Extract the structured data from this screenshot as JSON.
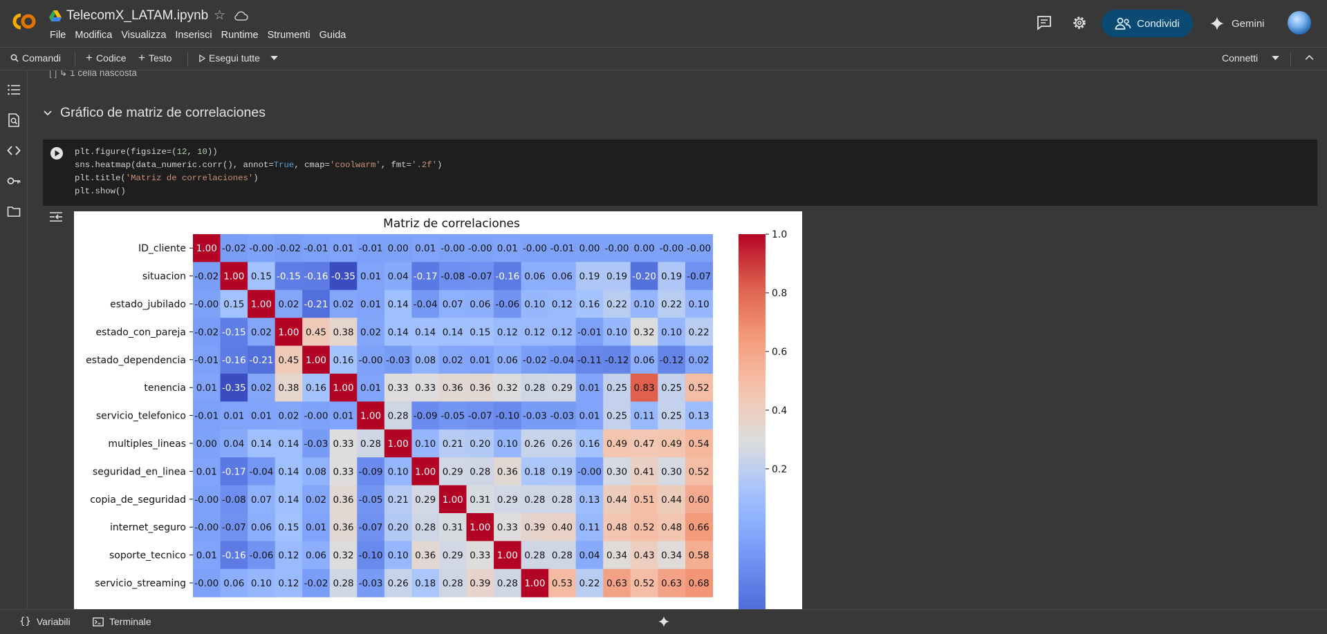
{
  "app": {
    "logo": "CO",
    "title": "TelecomX_LATAM.ipynb",
    "menu": [
      "File",
      "Modifica",
      "Visualizza",
      "Inserisci",
      "Runtime",
      "Strumenti",
      "Guida"
    ],
    "share_label": "Condividi",
    "gemini_label": "Gemini"
  },
  "toolbar": {
    "commands": "Comandi",
    "code": "Codice",
    "text": "Testo",
    "run_all": "Esegui tutte",
    "connect": "Connetti"
  },
  "notebook": {
    "hidden_cells": "↳ 1 cella nascosta",
    "section_title": "Gráfico de matriz de correlaciones",
    "code_lines": [
      "plt.figure(figsize=(12, 10))",
      "sns.heatmap(data_numeric.corr(), annot=True, cmap='coolwarm', fmt='.2f')",
      "plt.title('Matriz de correlaciones')",
      "plt.show()"
    ]
  },
  "status": {
    "variables": "Variabili",
    "terminal": "Terminale"
  },
  "chart_data": {
    "type": "heatmap",
    "title": "Matriz de correlaciones",
    "colormap": "coolwarm",
    "rows": [
      "ID_cliente",
      "situacion",
      "estado_jubilado",
      "estado_con_pareja",
      "estado_dependencia",
      "tenencia",
      "servicio_telefonico",
      "multiples_lineas",
      "seguridad_en_linea",
      "copia_de_seguridad",
      "internet_seguro",
      "soporte_tecnico",
      "servicio_streaming"
    ],
    "values": [
      [
        1.0,
        -0.02,
        -0.0,
        -0.02,
        -0.01,
        0.01,
        -0.01,
        0.0,
        0.01,
        -0.0,
        -0.0,
        0.01,
        -0.0,
        -0.01,
        0.0,
        -0.0,
        0.0,
        -0.0,
        -0.0
      ],
      [
        -0.02,
        1.0,
        0.15,
        -0.15,
        -0.16,
        -0.35,
        0.01,
        0.04,
        -0.17,
        -0.08,
        -0.07,
        -0.16,
        0.06,
        0.06,
        0.19,
        0.19,
        -0.2,
        0.19,
        -0.07
      ],
      [
        -0.0,
        0.15,
        1.0,
        0.02,
        -0.21,
        0.02,
        0.01,
        0.14,
        -0.04,
        0.07,
        0.06,
        -0.06,
        0.1,
        0.12,
        0.16,
        0.22,
        0.1,
        0.22,
        0.1
      ],
      [
        -0.02,
        -0.15,
        0.02,
        1.0,
        0.45,
        0.38,
        0.02,
        0.14,
        0.14,
        0.14,
        0.15,
        0.12,
        0.12,
        0.12,
        -0.01,
        0.1,
        0.32,
        0.1,
        0.22
      ],
      [
        -0.01,
        -0.16,
        -0.21,
        0.45,
        1.0,
        0.16,
        -0.0,
        -0.03,
        0.08,
        0.02,
        0.01,
        0.06,
        -0.02,
        -0.04,
        -0.11,
        -0.12,
        0.06,
        -0.12,
        0.02
      ],
      [
        0.01,
        -0.35,
        0.02,
        0.38,
        0.16,
        1.0,
        0.01,
        0.33,
        0.33,
        0.36,
        0.36,
        0.32,
        0.28,
        0.29,
        0.01,
        0.25,
        0.83,
        0.25,
        0.52
      ],
      [
        -0.01,
        0.01,
        0.01,
        0.02,
        -0.0,
        0.01,
        1.0,
        0.28,
        -0.09,
        -0.05,
        -0.07,
        -0.1,
        -0.03,
        -0.03,
        0.01,
        0.25,
        0.11,
        0.25,
        0.13
      ],
      [
        0.0,
        0.04,
        0.14,
        0.14,
        -0.03,
        0.33,
        0.28,
        1.0,
        0.1,
        0.21,
        0.2,
        0.1,
        0.26,
        0.26,
        0.16,
        0.49,
        0.47,
        0.49,
        0.54
      ],
      [
        0.01,
        -0.17,
        -0.04,
        0.14,
        0.08,
        0.33,
        -0.09,
        0.1,
        1.0,
        0.29,
        0.28,
        0.36,
        0.18,
        0.19,
        -0.0,
        0.3,
        0.41,
        0.3,
        0.52
      ],
      [
        -0.0,
        -0.08,
        0.07,
        0.14,
        0.02,
        0.36,
        -0.05,
        0.21,
        0.29,
        1.0,
        0.31,
        0.29,
        0.28,
        0.28,
        0.13,
        0.44,
        0.51,
        0.44,
        0.6
      ],
      [
        -0.0,
        -0.07,
        0.06,
        0.15,
        0.01,
        0.36,
        -0.07,
        0.2,
        0.28,
        0.31,
        1.0,
        0.33,
        0.39,
        0.4,
        0.11,
        0.48,
        0.52,
        0.48,
        0.66
      ],
      [
        0.01,
        -0.16,
        -0.06,
        0.12,
        0.06,
        0.32,
        -0.1,
        0.1,
        0.36,
        0.29,
        0.33,
        1.0,
        0.28,
        0.28,
        0.04,
        0.34,
        0.43,
        0.34,
        0.58
      ],
      [
        -0.0,
        0.06,
        0.1,
        0.12,
        -0.02,
        0.28,
        -0.03,
        0.26,
        0.18,
        0.28,
        0.39,
        0.28,
        1.0,
        0.53,
        0.22,
        0.63,
        0.52,
        0.63,
        0.68
      ]
    ],
    "colorbar_ticks": [
      1.0,
      0.8,
      0.6,
      0.4,
      0.2
    ],
    "colorbar_range": [
      -0.35,
      1.0
    ]
  }
}
